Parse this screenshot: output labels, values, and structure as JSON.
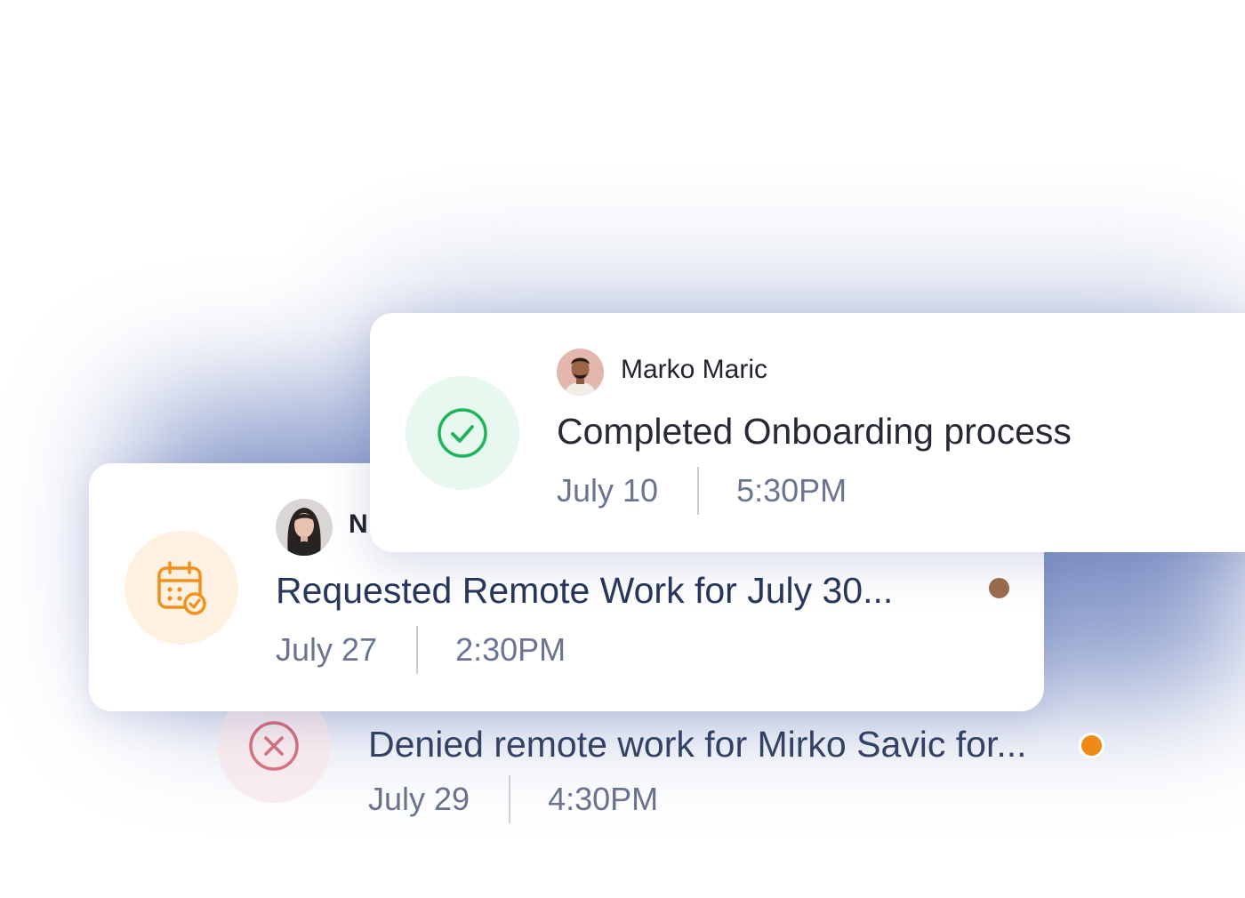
{
  "colors": {
    "success": "#1fb45b",
    "warning": "#f3901c",
    "danger": "#c8394a",
    "unread_dot_orange": "#ef8a16",
    "unread_dot_brown": "#9b6d4f",
    "title_text": "#28375b",
    "meta_text": "#6b7591"
  },
  "notifications": [
    {
      "author": "Marko Maric",
      "avatar": "avatar-marko-maric",
      "icon": "check-circle-icon",
      "title": "Completed Onboarding process",
      "date": "July 10",
      "time": "5:30PM"
    },
    {
      "author": "N",
      "avatar": "avatar-woman",
      "icon": "calendar-check-icon",
      "title": "Requested Remote Work for July 30...",
      "date": "July 27",
      "time": "2:30PM",
      "unread": true
    },
    {
      "icon": "x-circle-icon",
      "title": "Denied remote work for Mirko Savic for...",
      "date": "July 29",
      "time": "4:30PM",
      "unread": true
    }
  ]
}
